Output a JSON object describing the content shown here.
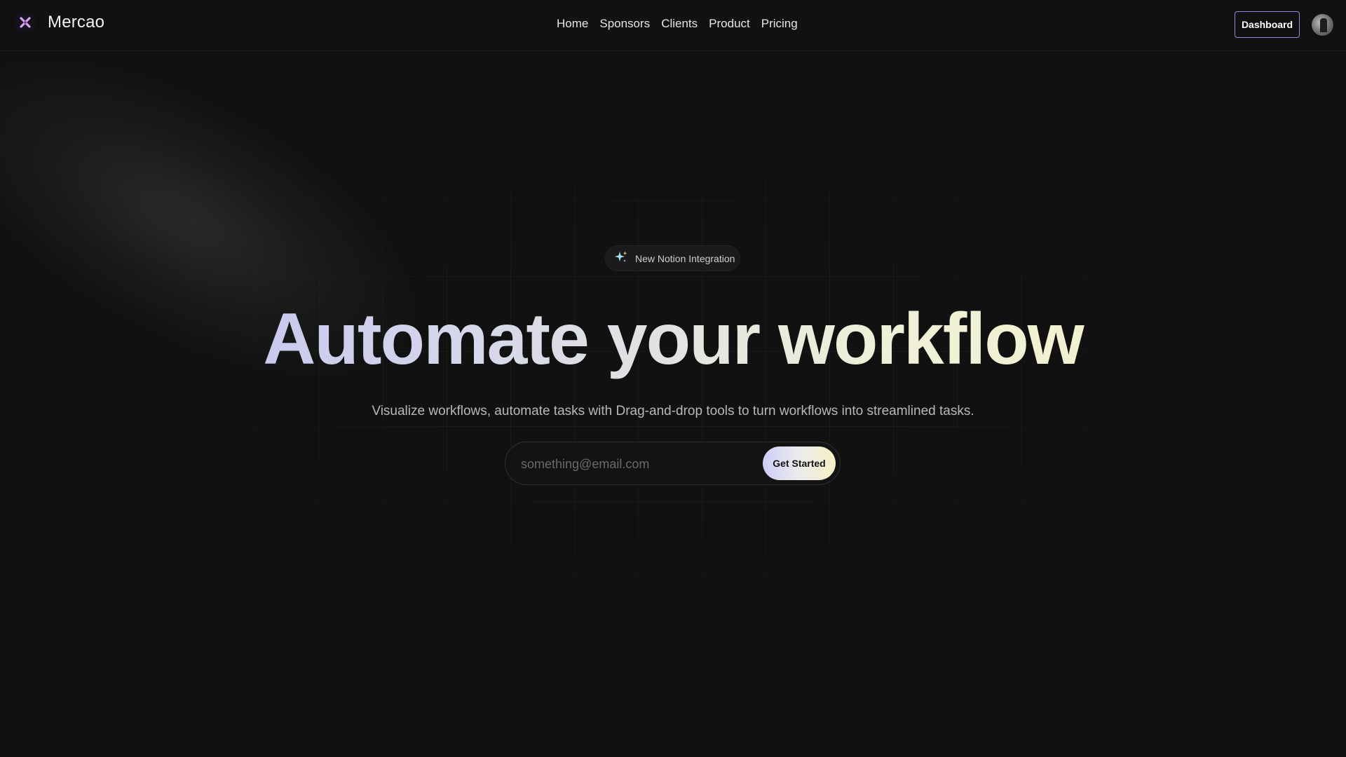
{
  "brand": {
    "name": "Mercao",
    "logo_icon": "x-spark-logo-icon",
    "accent": "#c06bd8"
  },
  "nav": {
    "items": [
      {
        "label": "Home"
      },
      {
        "label": "Sponsors"
      },
      {
        "label": "Clients"
      },
      {
        "label": "Product"
      },
      {
        "label": "Pricing"
      }
    ],
    "dashboard_label": "Dashboard",
    "dashboard_border": "#8f8ce6"
  },
  "hero": {
    "badge": {
      "icon": "sparkles-icon",
      "label": "New Notion Integration"
    },
    "title": "Automate your workflow",
    "subtitle": "Visualize workflows, automate tasks with Drag-and-drop tools to turn workflows into streamlined tasks.",
    "email_placeholder": "something@email.com",
    "cta_label": "Get Started",
    "gradient": [
      "#b9b8f3",
      "#f8f5c8"
    ]
  }
}
